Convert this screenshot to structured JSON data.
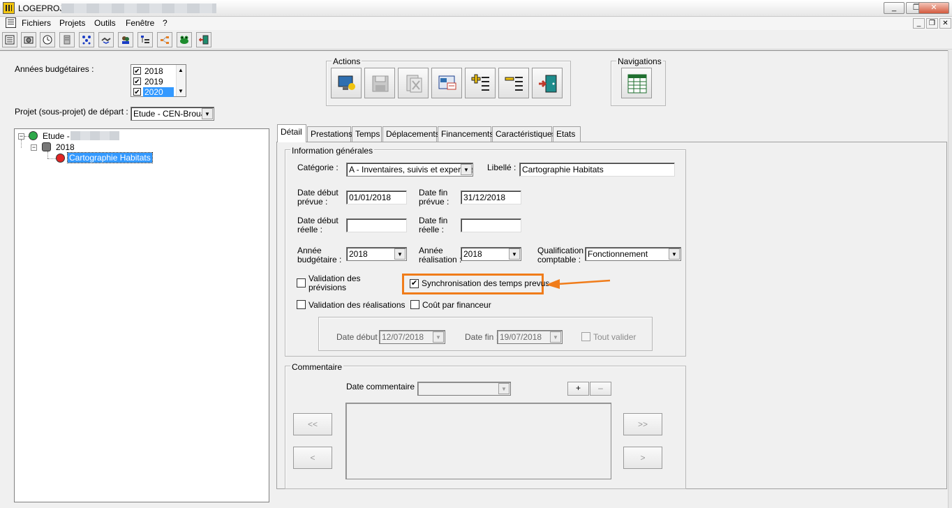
{
  "window": {
    "title": "LOGEPROJ",
    "minimize": "_",
    "maximize": "❐",
    "close": "✕"
  },
  "menu": {
    "items": [
      "Fichiers",
      "Projets",
      "Outils",
      "Fenêtre",
      "?"
    ],
    "mdi_min": "_",
    "mdi_restore": "❐",
    "mdi_close": "✕"
  },
  "toolbar": {
    "icons": [
      "list-icon",
      "camera-icon",
      "clock-icon",
      "document-icon",
      "network-icon",
      "handshake-icon",
      "users-icon",
      "hierarchy-icon",
      "organization-icon",
      "frog-icon",
      "exit-icon"
    ]
  },
  "left": {
    "years_label": "Années budgétaires :",
    "years": [
      {
        "label": "2018",
        "checked": true,
        "selected": false
      },
      {
        "label": "2019",
        "checked": true,
        "selected": false
      },
      {
        "label": "2020",
        "checked": true,
        "selected": true
      }
    ],
    "project_label": "Projet (sous-projet) de départ :",
    "project_value": "Etude - CEN-Brouag",
    "tree": {
      "root_label": "Etude -",
      "year_label": "2018",
      "leaf_label": "Cartographie Habitats"
    }
  },
  "actions": {
    "legend": "Actions",
    "buttons": [
      "new-icon",
      "save-icon",
      "delete-icon",
      "edit-icon",
      "add-icon",
      "remove-icon",
      "exit-icon"
    ]
  },
  "navigations": {
    "legend": "Navigations"
  },
  "tabs": [
    "Détail",
    "Prestations",
    "Temps",
    "Déplacements",
    "Financements",
    "Caractéristiques",
    "Etats"
  ],
  "info": {
    "legend": "Information générales",
    "categorie_label": "Catégorie  :",
    "categorie_value": "A - Inventaires, suivis et expertises",
    "libelle_label": "Libellé :",
    "libelle_value": "Cartographie Habitats",
    "date_debut_prevue_label1": "Date début",
    "date_debut_prevue_label2": "prévue :",
    "date_debut_prevue_value": "01/01/2018",
    "date_fin_prevue_label1": "Date fin",
    "date_fin_prevue_label2": "prévue :",
    "date_fin_prevue_value": "31/12/2018",
    "date_debut_reelle_label1": "Date début",
    "date_debut_reelle_label2": "réelle :",
    "date_debut_reelle_value": "",
    "date_fin_reelle_label1": "Date fin",
    "date_fin_reelle_label2": "réelle :",
    "date_fin_reelle_value": "",
    "annee_budg_label1": "Année",
    "annee_budg_label2": "budgétaire :",
    "annee_budg_value": "2018",
    "annee_real_label1": "Année",
    "annee_real_label2": "réalisation :",
    "annee_real_value": "2018",
    "qualif_label1": "Qualification",
    "qualif_label2": "comptable :",
    "qualif_value": "Fonctionnement",
    "validation_prev_label1": "Validation des",
    "validation_prev_label2": "prévisions",
    "sync_label": "Synchronisation des temps prevus",
    "validation_real_label": "Validation des réalisations",
    "cout_label": "Coût par financeur",
    "date_debut_label": "Date début :",
    "date_debut_value": "12/07/2018",
    "date_fin_label": "Date fin :",
    "date_fin_value": "19/07/2018",
    "tout_valider_label": "Tout valider",
    "highlight_color": "#f07c1a"
  },
  "comment": {
    "legend": "Commentaire",
    "date_label": "Date commentaire :",
    "date_value": "",
    "add": "+",
    "remove": "–",
    "first": "<<",
    "prev": "<",
    "last": ">>",
    "next": ">"
  }
}
